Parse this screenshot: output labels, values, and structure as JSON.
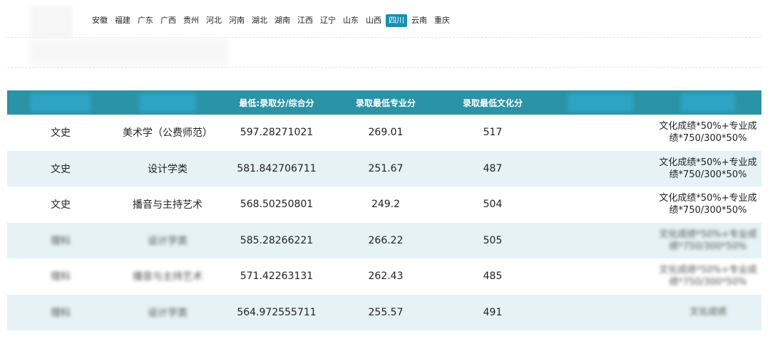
{
  "provinces": [
    "安徽",
    "福建",
    "广东",
    "广西",
    "贵州",
    "河北",
    "河南",
    "湖北",
    "湖南",
    "江西",
    "辽宁",
    "山东",
    "山西",
    "四川",
    "云南",
    "重庆"
  ],
  "active_province": "四川",
  "table": {
    "headers": [
      "",
      "",
      "最低:录取分/综合分",
      "录取最低专业分",
      "录取最低文化分",
      "",
      ""
    ],
    "rows": [
      {
        "category": "文史",
        "major": "美术学（公费师范）",
        "score": "597.28271021",
        "pro": "269.01",
        "cult": "517",
        "note1": "文化成绩*50%+专业成",
        "note2": "绩*750/300*50%"
      },
      {
        "category": "文史",
        "major": "设计学类",
        "score": "581.842706711",
        "pro": "251.67",
        "cult": "487",
        "note1": "文化成绩*50%+专业成",
        "note2": "绩*750/300*50%"
      },
      {
        "category": "文史",
        "major": "播音与主持艺术",
        "score": "568.50250801",
        "pro": "249.2",
        "cult": "504",
        "note1": "文化成绩*50%+专业成",
        "note2": "绩*750/300*50%"
      },
      {
        "category": "理科",
        "major": "设计学类",
        "score": "585.28266221",
        "pro": "266.22",
        "cult": "505",
        "note1": "文化成绩*50%+专业成",
        "note2": "绩*750/300*50%"
      },
      {
        "category": "理科",
        "major": "播音与主持艺术",
        "score": "571.42263131",
        "pro": "262.43",
        "cult": "485",
        "note1": "文化成绩*50%+专业成",
        "note2": "绩*750/300*50%"
      },
      {
        "category": "理科",
        "major": "设计学类",
        "score": "564.972555711",
        "pro": "255.57",
        "cult": "491",
        "note1": "",
        "note2": "文化成绩"
      }
    ]
  }
}
